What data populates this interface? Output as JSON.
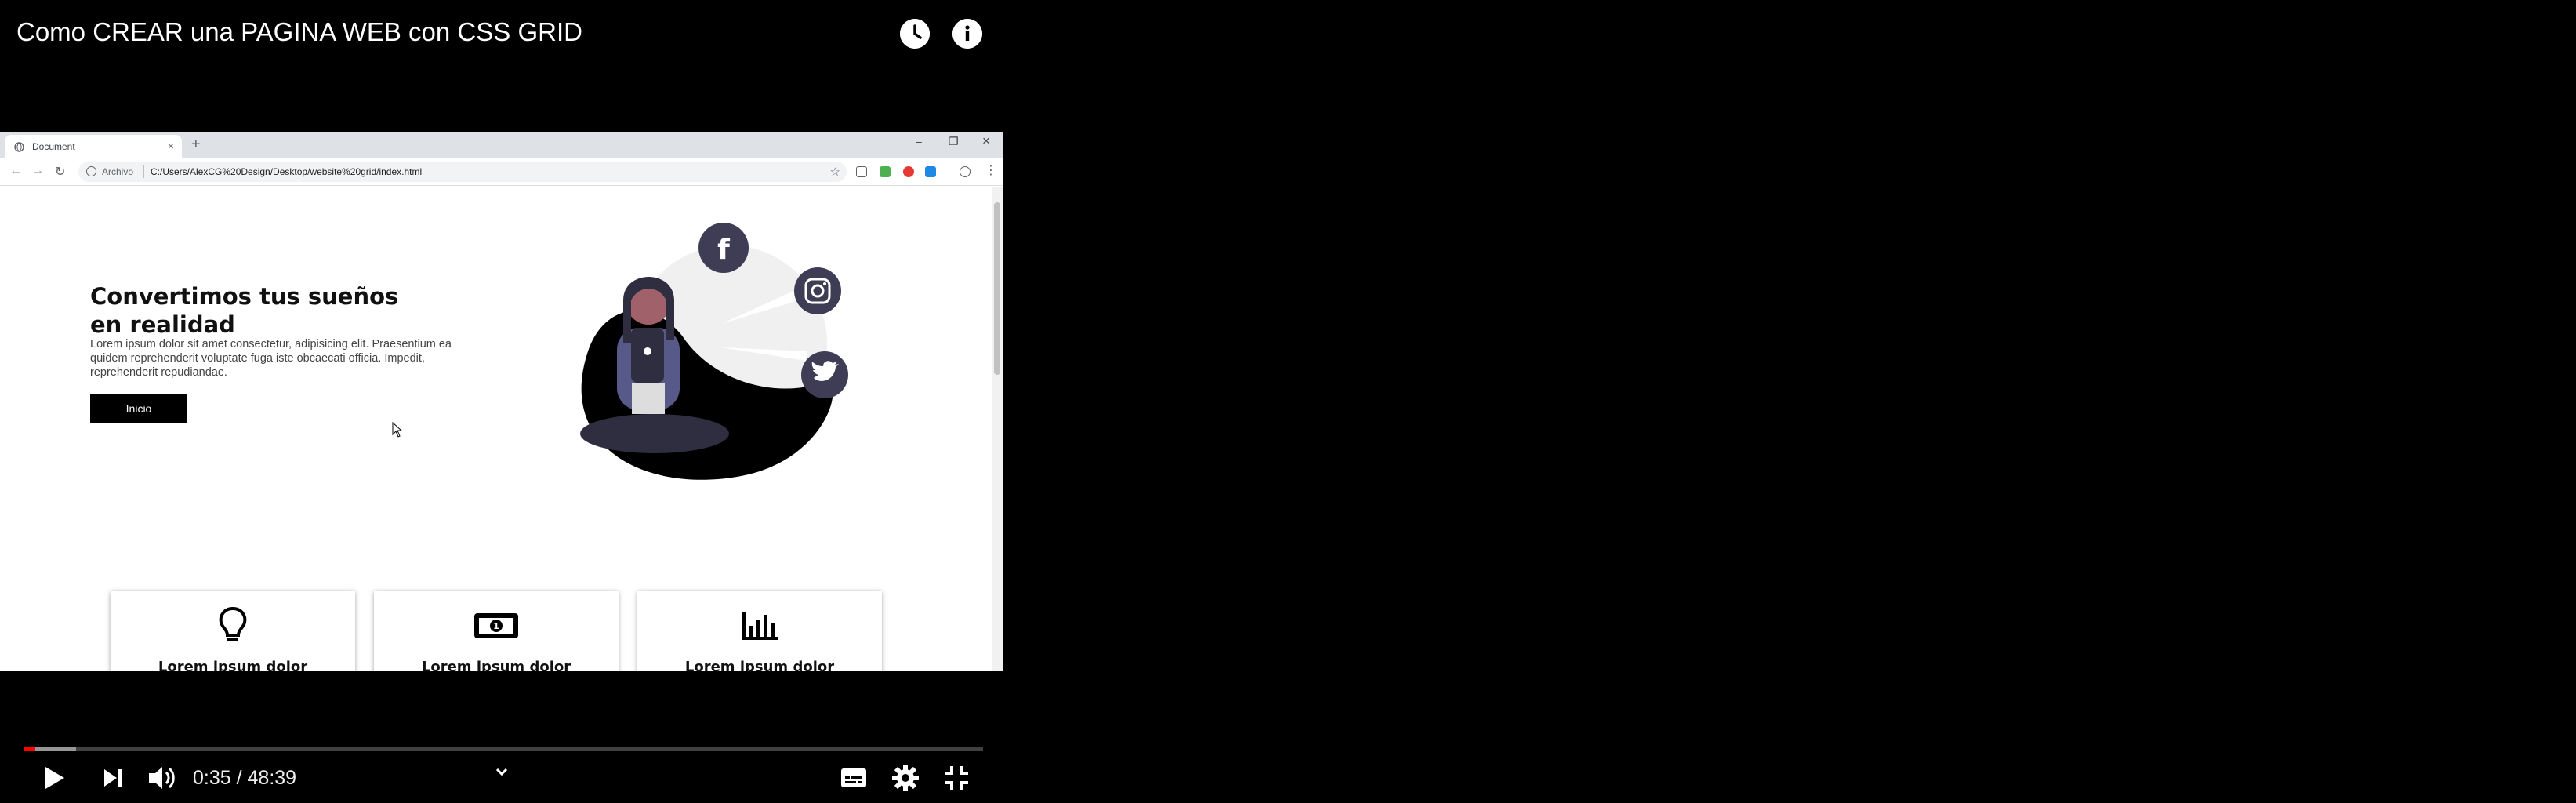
{
  "player": {
    "title": "Como CREAR una PAGINA WEB con CSS GRID",
    "time_current": "0:35",
    "time_separator": " / ",
    "time_total": "48:39",
    "progress_played_fraction": 0.012,
    "progress_buffered_fraction": 0.055,
    "icons": [
      "watch-later-icon",
      "info-icon",
      "play-icon",
      "next-icon",
      "volume-icon",
      "chevron-down-icon",
      "subtitles-icon",
      "settings-icon",
      "exit-fullscreen-icon"
    ],
    "accent_color": "#ff0000"
  },
  "browser": {
    "tab_title": "Document",
    "new_tab": "+",
    "tab_close": "×",
    "window_controls": {
      "minimize": "–",
      "restore": "❐",
      "close": "×"
    },
    "url_scheme": "Archivo",
    "url": "C:/Users/AlexCG%20Design/Desktop/website%20grid/index.html"
  },
  "page": {
    "hero_title": "Convertimos tus sueños en realidad",
    "hero_text": "Lorem ipsum dolor sit amet consectetur, adipisicing elit. Praesentium ea quidem reprehenderit voluptate fuga iste obcaecati officia. Impedit, reprehenderit repudiandae.",
    "hero_button": "Inicio",
    "social_icons": [
      "facebook-icon",
      "instagram-icon",
      "twitter-icon"
    ],
    "cards": [
      {
        "icon": "lightbulb-icon",
        "title": "Lorem ipsum dolor"
      },
      {
        "icon": "money-icon",
        "title": "Lorem ipsum dolor"
      },
      {
        "icon": "bar-chart-icon",
        "title": "Lorem ipsum dolor"
      }
    ]
  }
}
